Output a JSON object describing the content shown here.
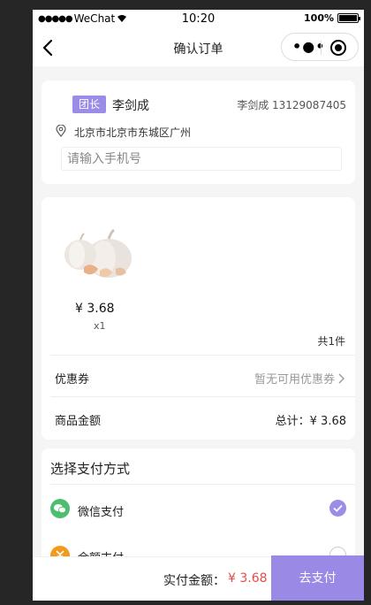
{
  "statusbar": {
    "carrier": "WeChat",
    "time": "10:20",
    "battery": "100%"
  },
  "navbar": {
    "title": "确认订单"
  },
  "leader": {
    "tag": "团长",
    "name": "李剑成",
    "contact": "李剑成  13129087405",
    "address": "北京市北京市东城区广州",
    "phone_placeholder": "请输入手机号"
  },
  "product": {
    "image": "garlic-image",
    "price": "¥ 3.68",
    "quantity": "x1",
    "count": "共1件"
  },
  "coupon": {
    "label": "优惠券",
    "value": "暂无可用优惠券"
  },
  "amount": {
    "label": "商品金额",
    "value": "总计：¥ 3.68"
  },
  "payment": {
    "title": "选择支付方式",
    "options": [
      {
        "label": "微信支付",
        "icon": "wechat-pay-icon",
        "color": "#4cbf6e",
        "selected": true
      },
      {
        "label": "余额支付",
        "icon": "balance-pay-icon",
        "color": "#f39a1e",
        "selected": false
      }
    ]
  },
  "footer": {
    "total_label": "实付金额：",
    "total_value": "¥ 3.68",
    "pay_button": "去支付"
  },
  "colors": {
    "accent": "#9b8ce8",
    "price_red": "#e84a4a"
  }
}
